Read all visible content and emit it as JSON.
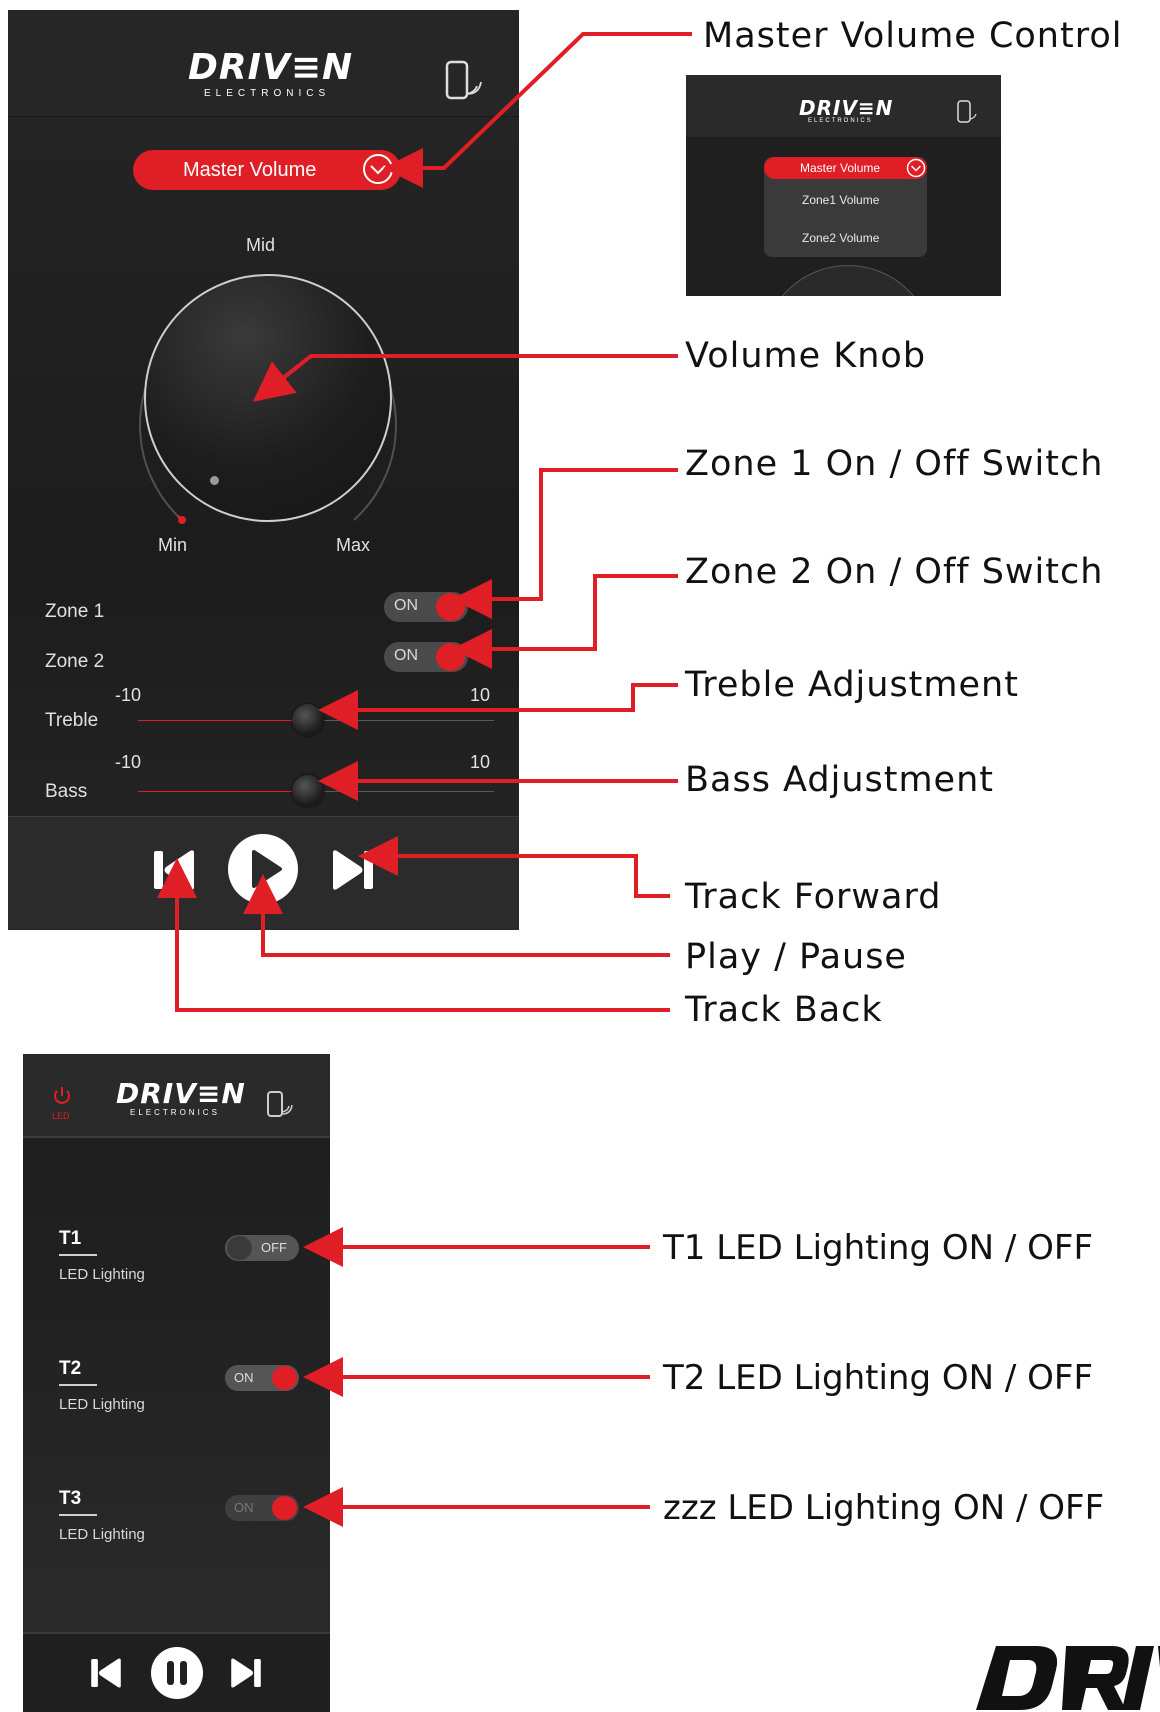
{
  "brand": {
    "logo_main": "DRIV≡N",
    "logo_sub": "ELECTRONICS"
  },
  "volume_screen": {
    "dropdown_label": "Master Volume",
    "knob": {
      "top_label": "Mid",
      "min_label": "Min",
      "max_label": "Max"
    },
    "zones": [
      {
        "label": "Zone 1",
        "toggle": "ON"
      },
      {
        "label": "Zone 2",
        "toggle": "ON"
      }
    ],
    "treble": {
      "label": "Treble",
      "min": "-10",
      "max": "10"
    },
    "bass": {
      "label": "Bass",
      "min": "-10",
      "max": "10"
    }
  },
  "dropdown_inset": {
    "selected": "Master Volume",
    "options": [
      "Zone1 Volume",
      "Zone2 Volume"
    ]
  },
  "annotations": {
    "master_volume_control": "Master Volume Control",
    "volume_knob": "Volume Knob",
    "zone1_switch": "Zone 1 On / Off Switch",
    "zone2_switch": "Zone 2 On / Off Switch",
    "treble": "Treble Adjustment",
    "bass": "Bass Adjustment",
    "track_forward": "Track Forward",
    "play_pause": "Play / Pause",
    "track_back": "Track Back",
    "t1_led": "T1 LED Lighting ON / OFF",
    "t2_led": "T2 LED Lighting ON / OFF",
    "t3_led": "zzz LED Lighting ON / OFF"
  },
  "led_screen": {
    "led_icon_label": "LED",
    "items": [
      {
        "title": "T1",
        "subtitle": "LED Lighting",
        "toggle": "OFF"
      },
      {
        "title": "T2",
        "subtitle": "LED Lighting",
        "toggle": "ON"
      },
      {
        "title": "T3",
        "subtitle": "LED Lighting",
        "toggle": "ON"
      }
    ]
  },
  "colors": {
    "accent": "#e01e26",
    "panel": "#262626",
    "text": "#e0e0e0"
  }
}
